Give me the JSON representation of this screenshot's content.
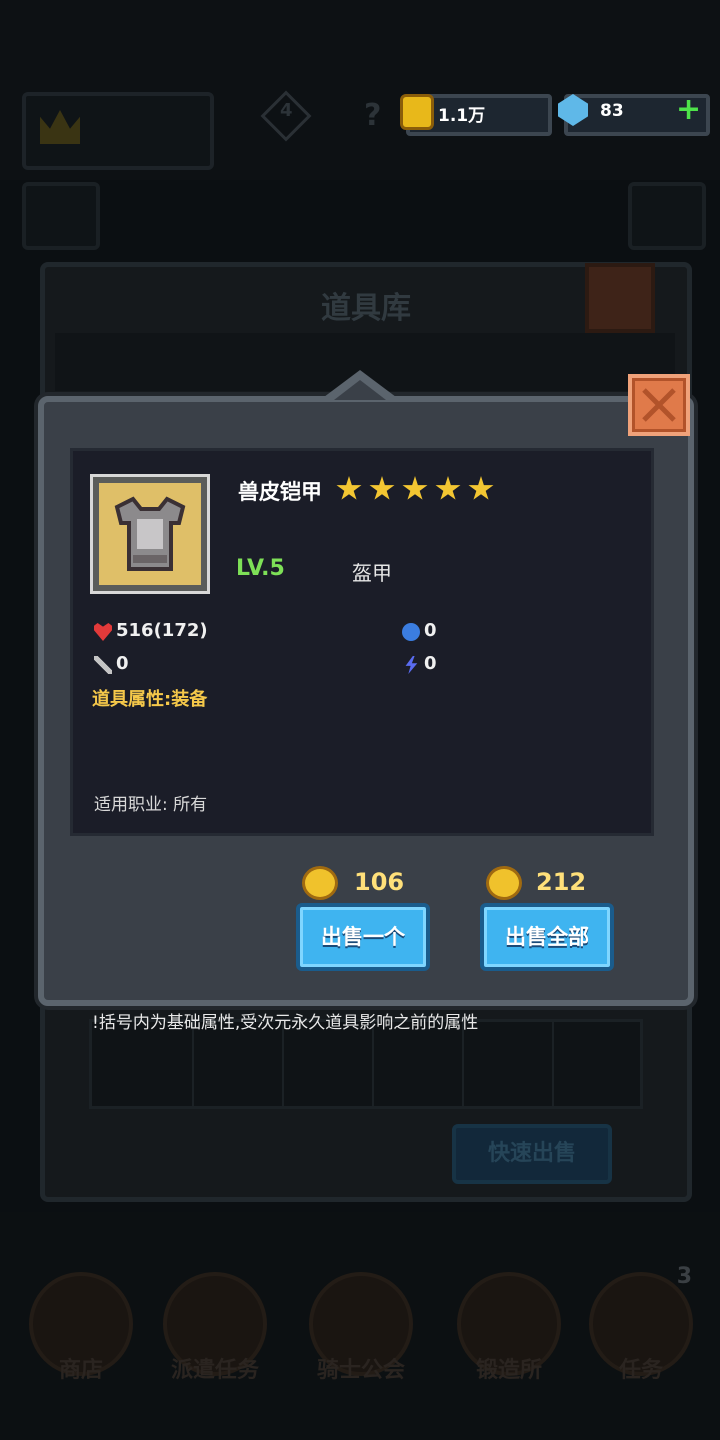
{
  "resources": {
    "gold": "1.1万",
    "gems": "83",
    "dim_hint": "4"
  },
  "background": {
    "panel_title": "道具库",
    "quick_sell_label": "快速出售"
  },
  "bottom_nav": {
    "items": [
      {
        "label": "商店"
      },
      {
        "label": "派遣任务"
      },
      {
        "label": "骑士公会"
      },
      {
        "label": "锻造所"
      },
      {
        "label": "任务",
        "badge": "3"
      }
    ]
  },
  "item": {
    "name": "兽皮铠甲",
    "star_count": 5,
    "level": "LV.5",
    "type": "盔甲",
    "hp": "516(172)",
    "mana": "0",
    "attack": "0",
    "energy": "0",
    "attribute": "道具属性:装备",
    "job": "适用职业:  所有"
  },
  "sell": {
    "one_price": "106",
    "all_price": "212",
    "one_label": "出售一个",
    "all_label": "出售全部"
  },
  "note": "!括号内为基础属性,受次元永久道具影响之前的属性",
  "colors": {
    "level_green": "#7ee057",
    "attr_gold": "#f5c84a",
    "sell_blue": "#3fb4f0",
    "close_orange": "#e07a4a"
  }
}
